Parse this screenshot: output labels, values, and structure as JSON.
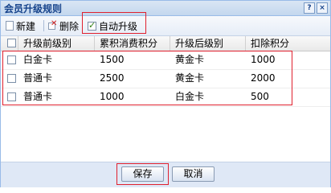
{
  "window": {
    "title": "会员升级规则",
    "help_label": "?",
    "close_label": "×"
  },
  "toolbar": {
    "new_label": "新建",
    "delete_label": "删除",
    "auto_upgrade_label": "自动升级",
    "auto_upgrade_checked": true
  },
  "grid": {
    "columns": [
      "升级前级别",
      "累积消费积分",
      "升级后级别",
      "扣除积分"
    ],
    "rows": [
      {
        "from": "白金卡",
        "points": "1500",
        "to": "黄金卡",
        "deduct": "1000"
      },
      {
        "from": "普通卡",
        "points": "2500",
        "to": "黄金卡",
        "deduct": "2000"
      },
      {
        "from": "普通卡",
        "points": "1000",
        "to": "白金卡",
        "deduct": "500"
      }
    ]
  },
  "footer": {
    "save_label": "保存",
    "cancel_label": "取消"
  },
  "colors": {
    "highlight": "#e0202e",
    "title_text": "#15428b",
    "panel_border": "#99bbe8"
  }
}
